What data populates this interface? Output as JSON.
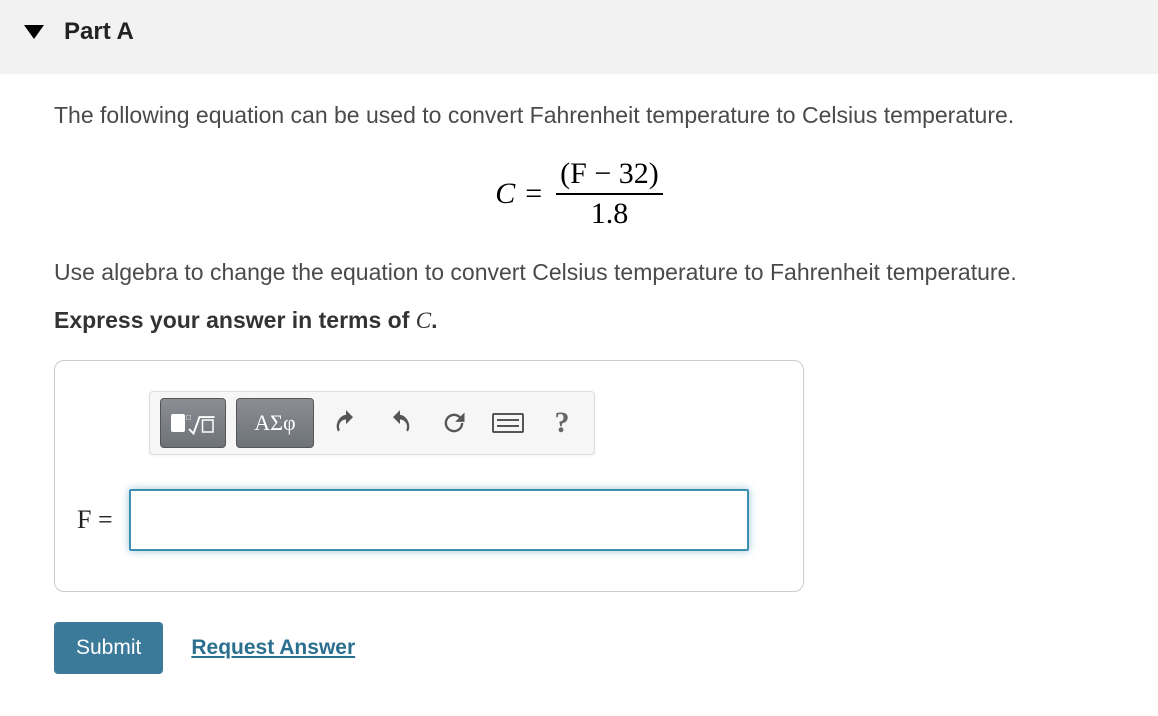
{
  "header": {
    "part_label": "Part A"
  },
  "body": {
    "intro": "The following equation can be used to convert Fahrenheit temperature to Celsius temperature.",
    "equation": {
      "lhs": "C",
      "eq": "=",
      "numerator": "(F − 32)",
      "denominator": "1.8"
    },
    "instruction": "Use algebra to change the equation to convert Celsius temperature to Fahrenheit temperature.",
    "express_prefix": "Express your answer in terms of ",
    "express_var": "C",
    "express_suffix": "."
  },
  "toolbar": {
    "greek_label": "ΑΣφ",
    "help_symbol": "?"
  },
  "input": {
    "label_var": "F",
    "label_eq": " = ",
    "value": ""
  },
  "actions": {
    "submit": "Submit",
    "request": "Request Answer"
  }
}
